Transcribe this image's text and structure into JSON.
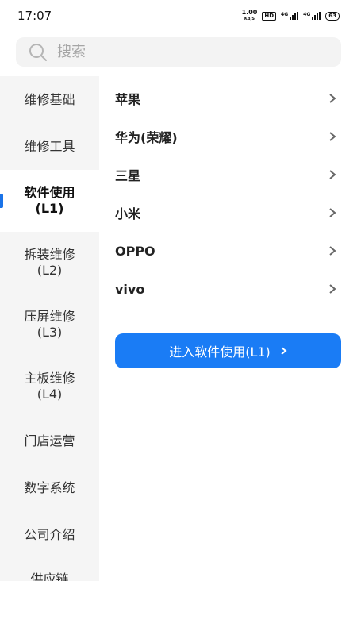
{
  "status": {
    "time": "17:07",
    "speed_value": "1.00",
    "speed_unit": "KB/S",
    "hd": "HD",
    "network_1": "4G",
    "network_2": "4G",
    "battery": "63"
  },
  "search": {
    "placeholder": "搜索"
  },
  "sidebar": {
    "items": [
      {
        "label": "维修基础"
      },
      {
        "label": "维修工具"
      },
      {
        "label": "软件使用",
        "sub": "(L1)"
      },
      {
        "label": "拆装维修",
        "sub": "(L2)"
      },
      {
        "label": "压屏维修",
        "sub": "(L3)"
      },
      {
        "label": "主板维修",
        "sub": "(L4)"
      },
      {
        "label": "门店运营"
      },
      {
        "label": "数字系统"
      },
      {
        "label": "公司介绍"
      },
      {
        "label": "供应链"
      }
    ],
    "active_index": 2
  },
  "brands": [
    {
      "label": "苹果"
    },
    {
      "label": "华为(荣耀)"
    },
    {
      "label": "三星"
    },
    {
      "label": "小米"
    },
    {
      "label": "OPPO"
    },
    {
      "label": "vivo"
    }
  ],
  "enter_button": {
    "label": "进入软件使用(L1)"
  },
  "colors": {
    "accent": "#1a7cf5",
    "sidebar_bg": "#f5f5f5"
  }
}
